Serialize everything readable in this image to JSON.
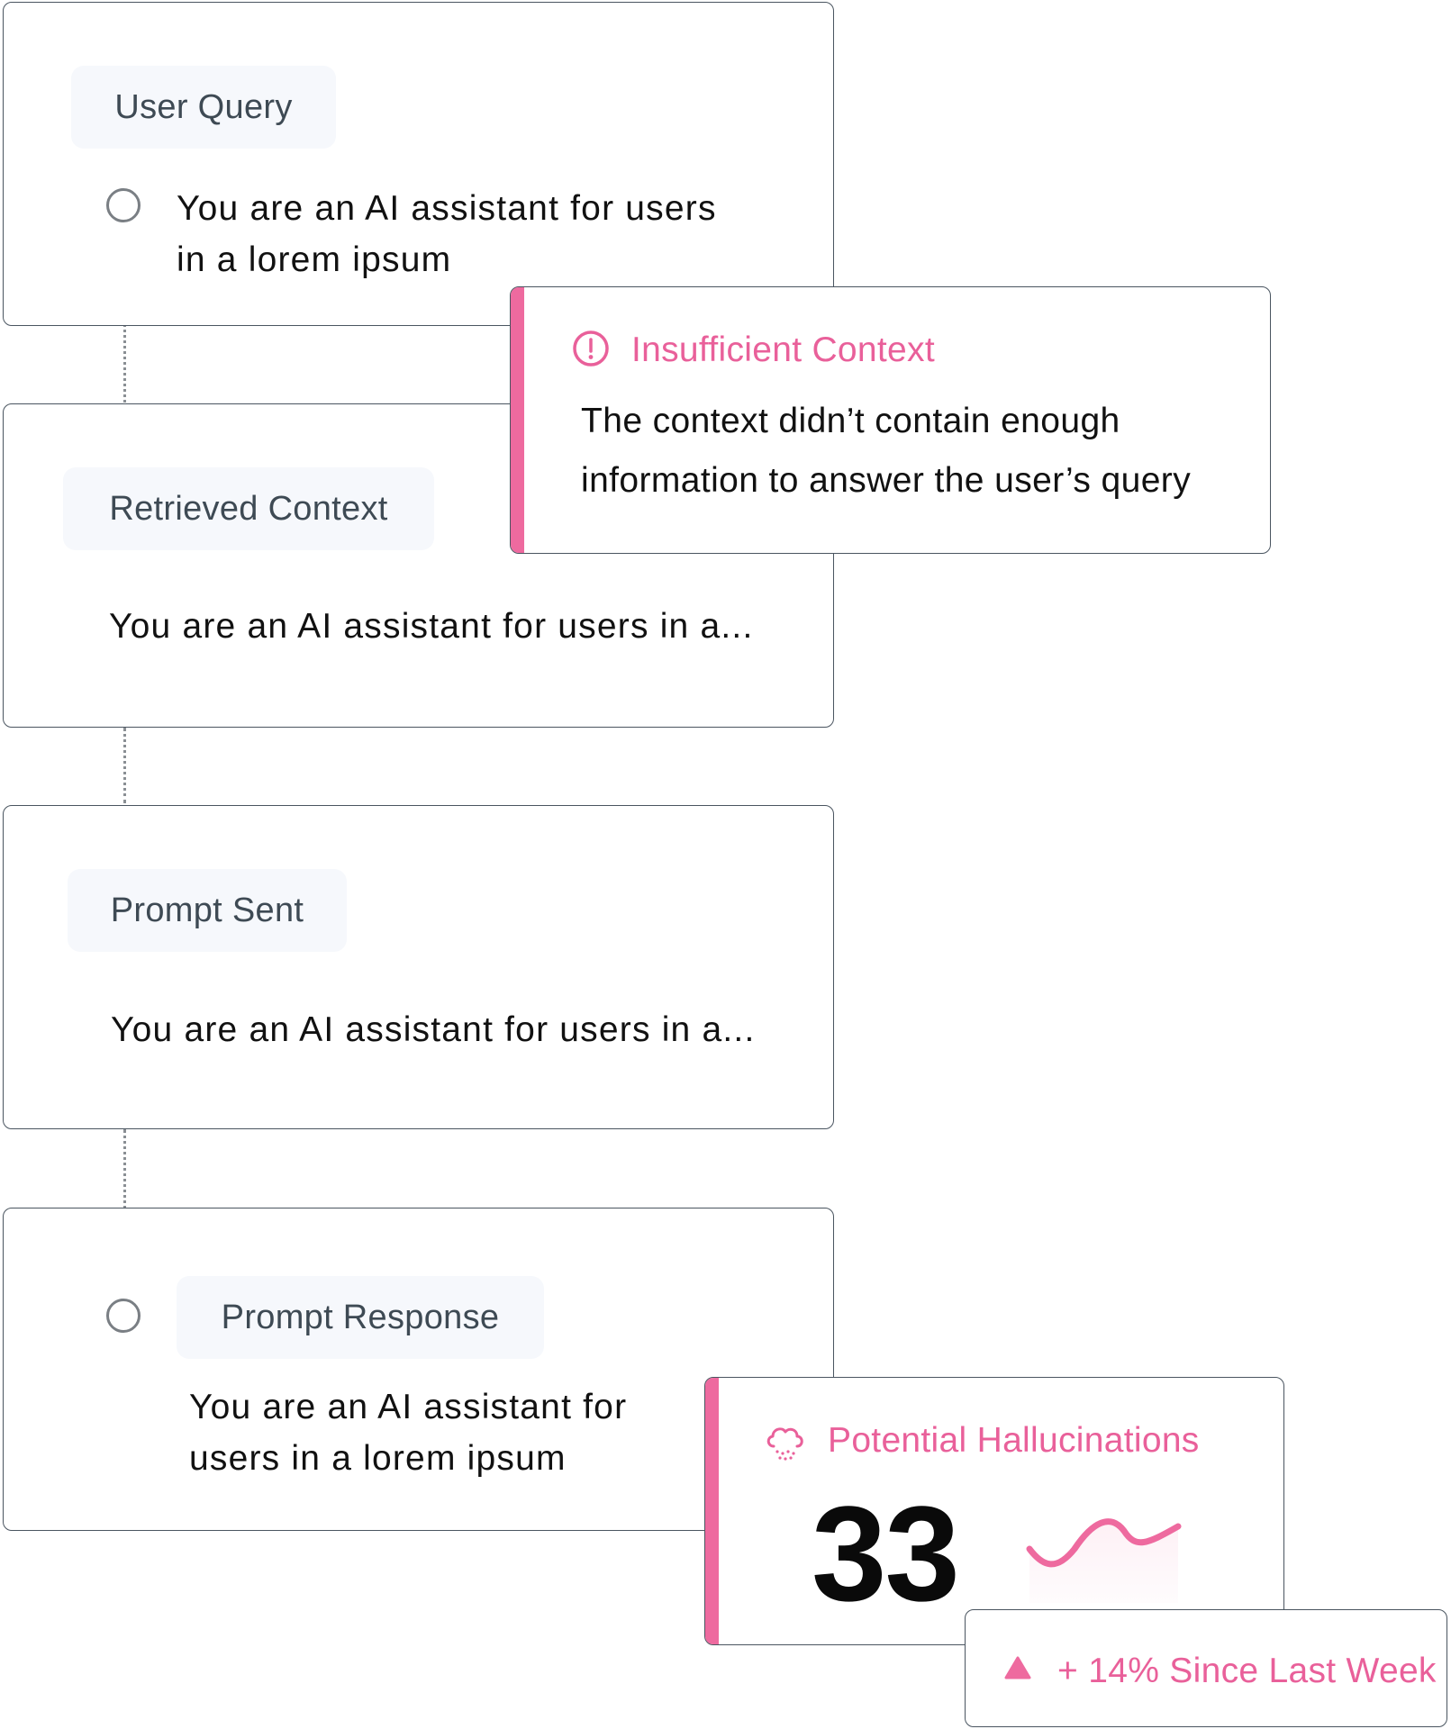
{
  "pipeline": {
    "user_query": {
      "label": "User Query",
      "text_lines": [
        "You are an AI assistant for users",
        "in a lorem ipsum"
      ]
    },
    "retrieved_context": {
      "label": "Retrieved Context",
      "text": "You are an AI assistant for users in a..."
    },
    "prompt_sent": {
      "label": "Prompt Sent",
      "text": "You are an AI assistant for users in a..."
    },
    "prompt_response": {
      "label": "Prompt Response",
      "text_lines": [
        "You are an AI assistant for",
        "users in a lorem ipsum"
      ]
    }
  },
  "insufficient_context": {
    "icon": "alert-circle-icon",
    "title": "Insufficient Context",
    "body_lines": [
      "The context didn’t contain enough",
      "information to answer the user’s query"
    ]
  },
  "hallucinations": {
    "icon": "cloud-icon",
    "title": "Potential Hallucinations",
    "value": "33",
    "trend": {
      "icon": "triangle-up-icon",
      "text": "+ 14% Since Last Week"
    }
  },
  "colors": {
    "accent": "#ee6a9f",
    "accent_text": "#e9609a",
    "border": "#4a5560",
    "pill_bg": "#f6f8fc",
    "connector": "#8a8f94"
  }
}
